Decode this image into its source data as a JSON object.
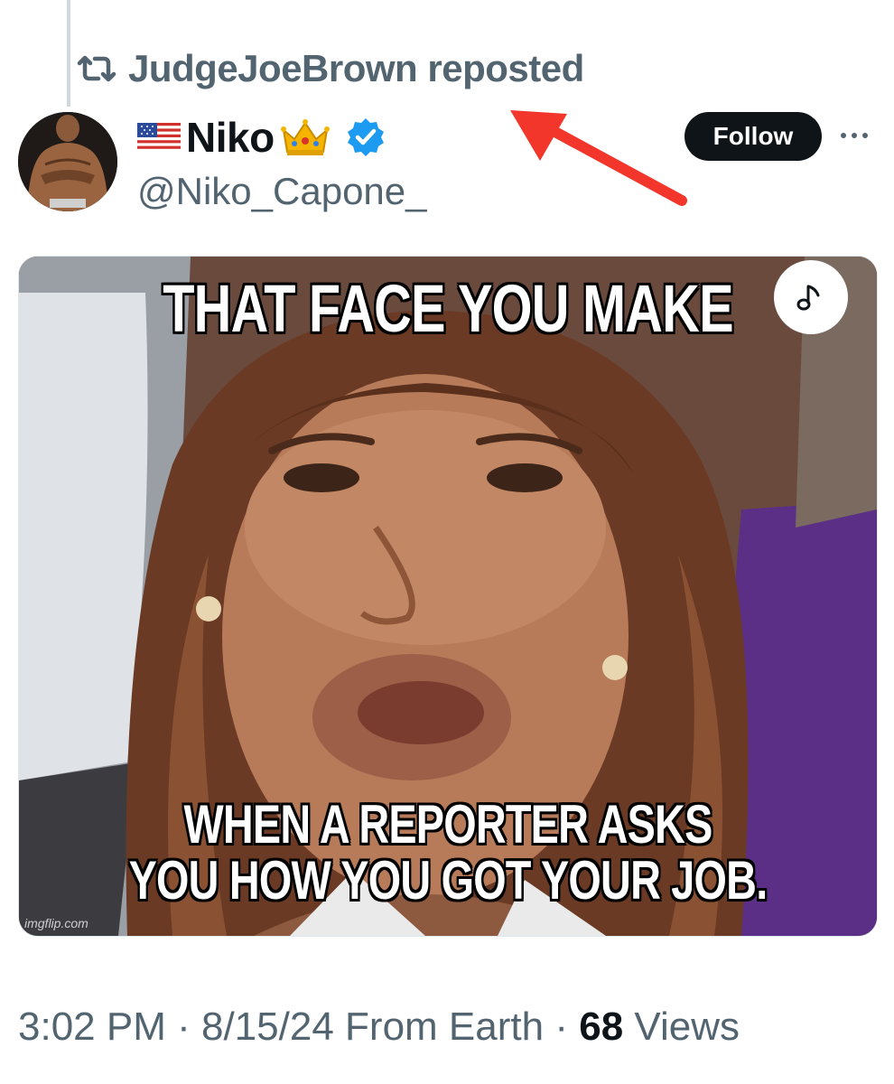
{
  "repost": {
    "reposter": "JudgeJoeBrown",
    "suffix": "reposted",
    "icon": "repost-icon"
  },
  "author": {
    "display_name": "Niko",
    "handle": "@Niko_Capone_",
    "prefix_emoji": "us-flag-emoji",
    "suffix_emoji": "crown-emoji",
    "verified": true,
    "verified_color": "#1d9bf0",
    "avatar": "avatar"
  },
  "follow_button": {
    "label": "Follow"
  },
  "media": {
    "top_caption": "THAT FACE YOU MAKE",
    "bottom_caption_line1": "WHEN A REPORTER ASKS",
    "bottom_caption_line2": "YOU HOW YOU GOT YOUR JOB.",
    "watermark": "imgflip.com",
    "sound_icon": "music-note-icon"
  },
  "meta": {
    "time": "3:02 PM",
    "date": "8/15/24",
    "source": "From Earth",
    "views_count": "68",
    "views_label": "Views",
    "separator": "·"
  },
  "annotation": {
    "arrow_color": "#f2362c"
  },
  "colors": {
    "text_primary": "#0f1419",
    "text_secondary": "#536471",
    "button_bg": "#0f1419",
    "thread_line": "#cfd9de"
  }
}
